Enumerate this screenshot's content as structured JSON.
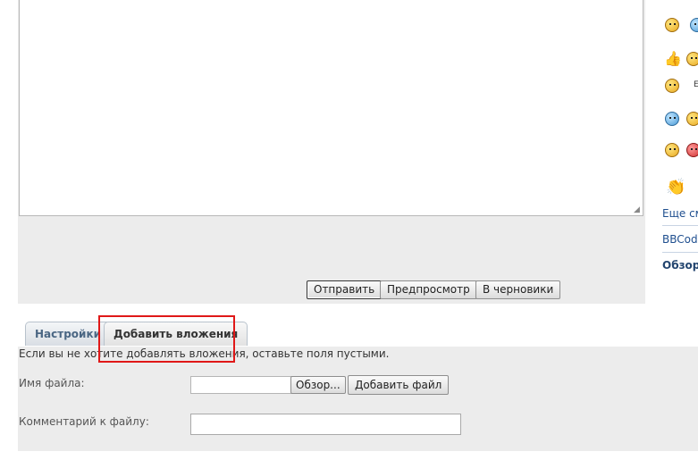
{
  "editor": {
    "message_value": "",
    "send_label": "Отправить",
    "preview_label": "Предпросмотр",
    "drafts_label": "В черновики"
  },
  "smilies": {
    "row3_text": "E",
    "more_label": "Еще см",
    "bbcode_label": "BBCod",
    "overview_label": "Обзор"
  },
  "tabs": {
    "settings_label": "Настройки",
    "attachments_label": "Добавить вложения"
  },
  "attachments": {
    "hint": "Если вы не хотите добавлять вложения, оставьте поля пустыми.",
    "filename_label": "Имя файла:",
    "browse_label": "Обзор...",
    "add_file_label": "Добавить файл",
    "comment_label": "Комментарий к файлу:",
    "comment_value": ""
  },
  "colors": {
    "highlight": "#e01818",
    "panel_background": "#ececec",
    "link": "#1f4f8f"
  }
}
